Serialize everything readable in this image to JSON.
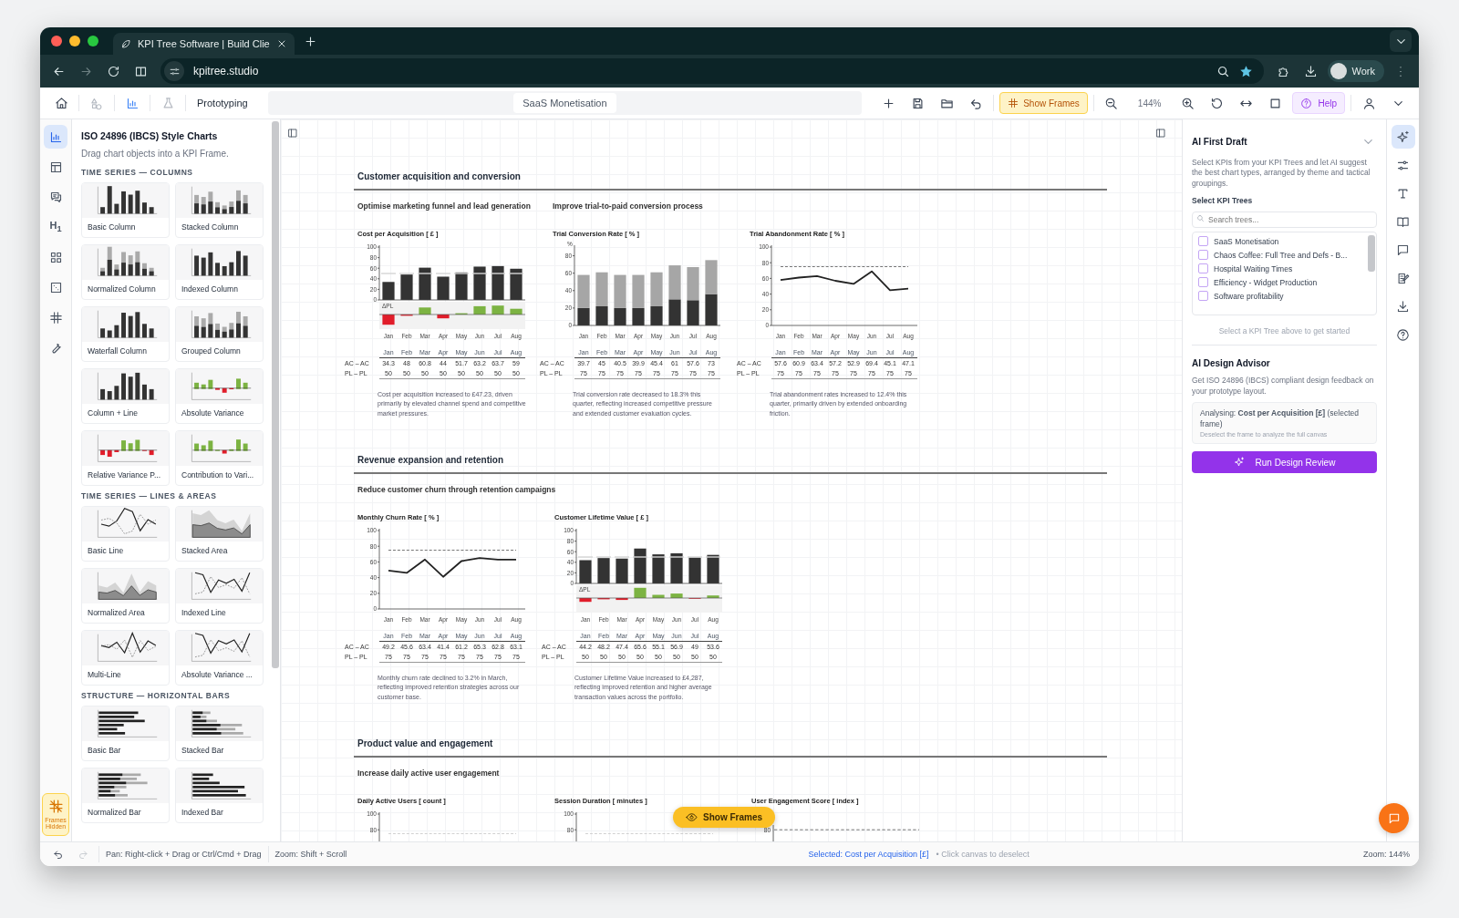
{
  "browser": {
    "tab": {
      "title": "KPI Tree Software | Build Clie",
      "selected": true
    },
    "url": "kpitree.studio",
    "profile": "Work"
  },
  "toolbar": {
    "mode": "Prototyping",
    "document": "SaaS Monetisation",
    "frames_button": "Show Frames",
    "zoom": "144%",
    "help_button": "Help"
  },
  "left_rail": {
    "items": [
      {
        "kind": "chart",
        "selected": true
      },
      {
        "kind": "table",
        "selected": false
      },
      {
        "kind": "comments",
        "selected": false
      },
      {
        "kind": "heading",
        "label": "H$_{1}$",
        "selected": false
      },
      {
        "kind": "grid",
        "selected": false
      },
      {
        "kind": "dice",
        "selected": false
      },
      {
        "kind": "frame",
        "selected": false
      },
      {
        "kind": "wrench",
        "selected": false
      }
    ],
    "frames_toggle": "Frames Hidden"
  },
  "library": {
    "title": "ISO 24896 (IBCS) Style Charts",
    "hint": "Drag chart objects into a KPI Frame.",
    "sections": [
      {
        "title": "TIME SERIES — COLUMNS",
        "items": [
          {
            "label": "Basic Column",
            "kind": "column"
          },
          {
            "label": "Stacked Column",
            "kind": "stacked"
          },
          {
            "label": "Normalized Column",
            "kind": "stacked"
          },
          {
            "label": "Indexed Column",
            "kind": "column"
          },
          {
            "label": "Waterfall Column",
            "kind": "column"
          },
          {
            "label": "Grouped Column",
            "kind": "stacked"
          },
          {
            "label": "Column + Line",
            "kind": "column"
          },
          {
            "label": "Absolute Variance",
            "kind": "variance"
          },
          {
            "label": "Relative Variance P...",
            "kind": "variance"
          },
          {
            "label": "Contribution to Vari...",
            "kind": "variance"
          }
        ]
      },
      {
        "title": "TIME SERIES — LINES & AREAS",
        "items": [
          {
            "label": "Basic Line",
            "kind": "line"
          },
          {
            "label": "Stacked Area",
            "kind": "area"
          },
          {
            "label": "Normalized Area",
            "kind": "area"
          },
          {
            "label": "Indexed Line",
            "kind": "line"
          },
          {
            "label": "Multi-Line",
            "kind": "line"
          },
          {
            "label": "Absolute Variance ...",
            "kind": "line"
          }
        ]
      },
      {
        "title": "STRUCTURE — HORIZONTAL BARS",
        "items": [
          {
            "label": "Basic Bar",
            "kind": "bar"
          },
          {
            "label": "Stacked Bar",
            "kind": "stacked_bar"
          },
          {
            "label": "Normalized Bar",
            "kind": "stacked_bar"
          },
          {
            "label": "Indexed Bar",
            "kind": "bar"
          }
        ]
      }
    ]
  },
  "canvas": {
    "sections": [
      {
        "title": "Customer acquisition and conversion",
        "groups": [
          {
            "title": "Optimise marketing funnel and lead generation",
            "charts": [
              {
                "chart_data": {
                  "type": "bar",
                  "title": "Cost per Acquisition [ £ ]",
                  "categories": [
                    "Jan",
                    "Feb",
                    "Mar",
                    "Apr",
                    "May",
                    "Jun",
                    "Jul",
                    "Aug"
                  ],
                  "ylim": [
                    0,
                    100
                  ],
                  "yticks": [
                    0,
                    20,
                    40,
                    60,
                    80,
                    100
                  ],
                  "series": [
                    {
                      "color": "#333333",
                      "values": [
                        34,
                        48,
                        61,
                        44,
                        52,
                        63,
                        64,
                        59
                      ]
                    }
                  ]
                },
                "delta_label": "ΔPL",
                "table": {
                  "columns": [
                    "Jan",
                    "Feb",
                    "Mar",
                    "Apr",
                    "May",
                    "Jun",
                    "Jul",
                    "Aug"
                  ],
                  "rows": [
                    {
                      "label": "AC – AC",
                      "cells": [
                        "34.3",
                        "48",
                        "60.8",
                        "44",
                        "51.7",
                        "63.2",
                        "63.7",
                        "59"
                      ]
                    },
                    {
                      "label": "PL – PL",
                      "cells": [
                        "50",
                        "50",
                        "50",
                        "50",
                        "50",
                        "50",
                        "50",
                        "50"
                      ]
                    }
                  ]
                },
                "caption": "Cost per acquisition increased to £47.23, driven primarily by elevated channel spend and competitive market pressures."
              }
            ]
          },
          {
            "title": "Improve trial-to-paid conversion process",
            "charts": [
              {
                "chart_data": {
                  "type": "bar",
                  "title": "Trial Conversion Rate [ % ]",
                  "ylabel": "%",
                  "stacked": true,
                  "categories": [
                    "Jan",
                    "Feb",
                    "Mar",
                    "Apr",
                    "May",
                    "Jun",
                    "Jul",
                    "Aug"
                  ],
                  "ylim": [
                    0,
                    90
                  ],
                  "yticks": [
                    0,
                    20,
                    40,
                    60,
                    80
                  ],
                  "series": [
                    {
                      "color": "#333333",
                      "values": [
                        20,
                        22,
                        20,
                        20,
                        22,
                        30,
                        29,
                        36
                      ]
                    },
                    {
                      "color": "#a6a6a6",
                      "values": [
                        38,
                        39,
                        38,
                        38,
                        39,
                        39,
                        38,
                        39
                      ]
                    }
                  ]
                },
                "table": {
                  "columns": [
                    "Jan",
                    "Feb",
                    "Mar",
                    "Apr",
                    "May",
                    "Jun",
                    "Jul",
                    "Aug"
                  ],
                  "rows": [
                    {
                      "label": "AC – AC",
                      "cells": [
                        "39.7",
                        "45",
                        "40.5",
                        "39.9",
                        "45.4",
                        "61",
                        "57.6",
                        "73"
                      ]
                    },
                    {
                      "label": "PL – PL",
                      "cells": [
                        "75",
                        "75",
                        "75",
                        "75",
                        "75",
                        "75",
                        "75",
                        "75"
                      ]
                    }
                  ]
                },
                "caption": "Trial conversion rate decreased to 18.3% this quarter, reflecting increased competitive pressure and extended customer evaluation cycles."
              },
              {
                "chart_data": {
                  "type": "line",
                  "title": "Trial Abandonment Rate [ % ]",
                  "categories": [
                    "Jan",
                    "Feb",
                    "Mar",
                    "Apr",
                    "May",
                    "Jun",
                    "Jul",
                    "Aug"
                  ],
                  "ylim": [
                    0,
                    100
                  ],
                  "yticks": [
                    0,
                    20,
                    40,
                    60,
                    80,
                    100
                  ],
                  "series": [
                    {
                      "color": "#222222",
                      "values": [
                        58,
                        61,
                        63,
                        57,
                        53,
                        69,
                        45,
                        47
                      ]
                    },
                    {
                      "color": "#666666",
                      "line_style": "dashed",
                      "values": [
                        75,
                        75,
                        75,
                        75,
                        75,
                        75,
                        75,
                        75
                      ]
                    }
                  ]
                },
                "table": {
                  "columns": [
                    "Jan",
                    "Feb",
                    "Mar",
                    "Apr",
                    "May",
                    "Jun",
                    "Jul",
                    "Aug"
                  ],
                  "rows": [
                    {
                      "label": "AC – AC",
                      "cells": [
                        "57.6",
                        "60.9",
                        "63.4",
                        "57.2",
                        "52.9",
                        "69.4",
                        "45.1",
                        "47.1"
                      ]
                    },
                    {
                      "label": "PL – PL",
                      "cells": [
                        "75",
                        "75",
                        "75",
                        "75",
                        "75",
                        "75",
                        "75",
                        "75"
                      ]
                    }
                  ]
                },
                "caption": "Trial abandonment rates increased to 12.4% this quarter, primarily driven by extended onboarding friction."
              }
            ]
          }
        ]
      },
      {
        "title": "Revenue expansion and retention",
        "groups": [
          {
            "title": "Reduce customer churn through retention campaigns",
            "charts": [
              {
                "chart_data": {
                  "type": "line",
                  "title": "Monthly Churn Rate [ % ]",
                  "categories": [
                    "Jan",
                    "Feb",
                    "Mar",
                    "Apr",
                    "May",
                    "Jun",
                    "Jul",
                    "Aug"
                  ],
                  "ylim": [
                    0,
                    100
                  ],
                  "yticks": [
                    0,
                    20,
                    40,
                    60,
                    80,
                    100
                  ],
                  "series": [
                    {
                      "color": "#222222",
                      "values": [
                        49,
                        46,
                        63,
                        41,
                        61,
                        65,
                        63,
                        63
                      ]
                    },
                    {
                      "color": "#666666",
                      "line_style": "dashed",
                      "values": [
                        75,
                        75,
                        75,
                        75,
                        75,
                        75,
                        75,
                        75
                      ]
                    }
                  ]
                },
                "table": {
                  "columns": [
                    "Jan",
                    "Feb",
                    "Mar",
                    "Apr",
                    "May",
                    "Jun",
                    "Jul",
                    "Aug"
                  ],
                  "rows": [
                    {
                      "label": "AC – AC",
                      "cells": [
                        "49.2",
                        "45.6",
                        "63.4",
                        "41.4",
                        "61.2",
                        "65.3",
                        "62.8",
                        "63.1"
                      ]
                    },
                    {
                      "label": "PL – PL",
                      "cells": [
                        "75",
                        "75",
                        "75",
                        "75",
                        "75",
                        "75",
                        "75",
                        "75"
                      ]
                    }
                  ]
                },
                "caption": "Monthly churn rate declined to 3.2% in March, reflecting improved retention strategies across our customer base."
              },
              {
                "chart_data": {
                  "type": "bar",
                  "title": "Customer Lifetime Value [ £ ]",
                  "categories": [
                    "Jan",
                    "Feb",
                    "Mar",
                    "Apr",
                    "May",
                    "Jun",
                    "Jul",
                    "Aug"
                  ],
                  "ylim": [
                    0,
                    100
                  ],
                  "yticks": [
                    0,
                    20,
                    40,
                    60,
                    80,
                    100
                  ],
                  "series": [
                    {
                      "color": "#333333",
                      "values": [
                        44,
                        48,
                        47,
                        66,
                        55,
                        57,
                        49,
                        54
                      ]
                    }
                  ]
                },
                "delta_label": "ΔPL",
                "table": {
                  "columns": [
                    "Jan",
                    "Feb",
                    "Mar",
                    "Apr",
                    "May",
                    "Jun",
                    "Jul",
                    "Aug"
                  ],
                  "rows": [
                    {
                      "label": "AC – AC",
                      "cells": [
                        "44.2",
                        "48.2",
                        "47.4",
                        "65.6",
                        "55.1",
                        "56.9",
                        "49",
                        "53.6"
                      ]
                    },
                    {
                      "label": "PL – PL",
                      "cells": [
                        "50",
                        "50",
                        "50",
                        "50",
                        "50",
                        "50",
                        "50",
                        "50"
                      ]
                    }
                  ]
                },
                "caption": "Customer Lifetime Value increased to £4,287, reflecting improved retention and higher average transaction values across the portfolio."
              }
            ]
          }
        ]
      },
      {
        "title": "Product value and engagement",
        "groups": [
          {
            "title": "Increase daily active user engagement",
            "charts": [
              {
                "chart_data": {
                  "type": "line",
                  "title": "Daily Active Users [ count ]",
                  "categories": [
                    null,
                    null,
                    null,
                    null,
                    null,
                    null,
                    null,
                    null
                  ],
                  "ylim": [
                    0,
                    100
                  ],
                  "yticks": [
                    80,
                    100
                  ],
                  "series": [
                    {
                      "color": "#cccccc",
                      "line_style": "dashed",
                      "values": [
                        75,
                        75,
                        75,
                        75,
                        75,
                        75,
                        75,
                        75
                      ]
                    }
                  ]
                }
              },
              {
                "chart_data": {
                  "type": "line",
                  "title": "Session Duration [ minutes ]",
                  "categories": [
                    null,
                    null,
                    null,
                    null,
                    null,
                    null,
                    null,
                    null
                  ],
                  "ylim": [
                    0,
                    100
                  ],
                  "yticks": [
                    80,
                    100
                  ],
                  "series": [
                    {
                      "color": "#cccccc",
                      "line_style": "dashed",
                      "values": [
                        75,
                        75,
                        75,
                        75,
                        75,
                        75,
                        75,
                        75
                      ]
                    }
                  ]
                }
              },
              {
                "chart_data": {
                  "type": "other",
                  "title": "User Engagement Score [ index ]",
                  "annotations": [
                    {
                      "text": "80"
                    }
                  ],
                  "ref_lines": [
                    {
                      "line_style": "dashed",
                      "color": "#666666"
                    }
                  ]
                }
              }
            ]
          }
        ]
      }
    ],
    "floating_button": "Show Frames"
  },
  "ai_panel": {
    "first_draft": {
      "title": "AI First Draft",
      "description": "Select KPIs from your KPI Trees and let AI suggest the best chart types, arranged by theme and tactical groupings.",
      "trees_label": "Select KPI Trees",
      "search": {
        "placeholder": "Search trees..."
      },
      "trees": [
        {
          "label": "SaaS Monetisation",
          "checked": false
        },
        {
          "label": "Chaos Coffee: Full Tree and Defs - B...",
          "checked": false
        },
        {
          "label": "Hospital Waiting Times",
          "checked": false
        },
        {
          "label": "Efficiency - Widget Production",
          "checked": false
        },
        {
          "label": "Software profitability",
          "checked": false
        }
      ],
      "hint": "Select a KPI Tree above to get started"
    },
    "design_advisor": {
      "title": "AI Design Advisor",
      "description": "Get ISO 24896 (IBCS) compliant design feedback on your prototype layout.",
      "analysing": "Analysing: **Cost per Acquisition [£]** (selected frame)",
      "analysing_note": "Deselect the frame to analyze the full canvas",
      "button": "Run Design Review"
    }
  },
  "right_rail": {
    "items": [
      {
        "kind": "sparkle",
        "selected": true
      },
      {
        "kind": "sliders",
        "selected": false
      },
      {
        "kind": "text",
        "selected": false
      },
      {
        "kind": "book",
        "selected": false
      },
      {
        "kind": "comment",
        "selected": false
      },
      {
        "kind": "notes",
        "selected": false
      },
      {
        "kind": "download",
        "selected": false
      },
      {
        "kind": "help",
        "selected": false
      }
    ]
  },
  "status_bar": {
    "pan_hint": "Pan: Right-click + Drag or Ctrl/Cmd + Drag",
    "zoom_hint": "Zoom: Shift + Scroll",
    "selection": "Selected: Cost per Acquisition [£]",
    "deselect_hint": "• Click canvas to deselect",
    "zoom": "Zoom: 144%"
  }
}
